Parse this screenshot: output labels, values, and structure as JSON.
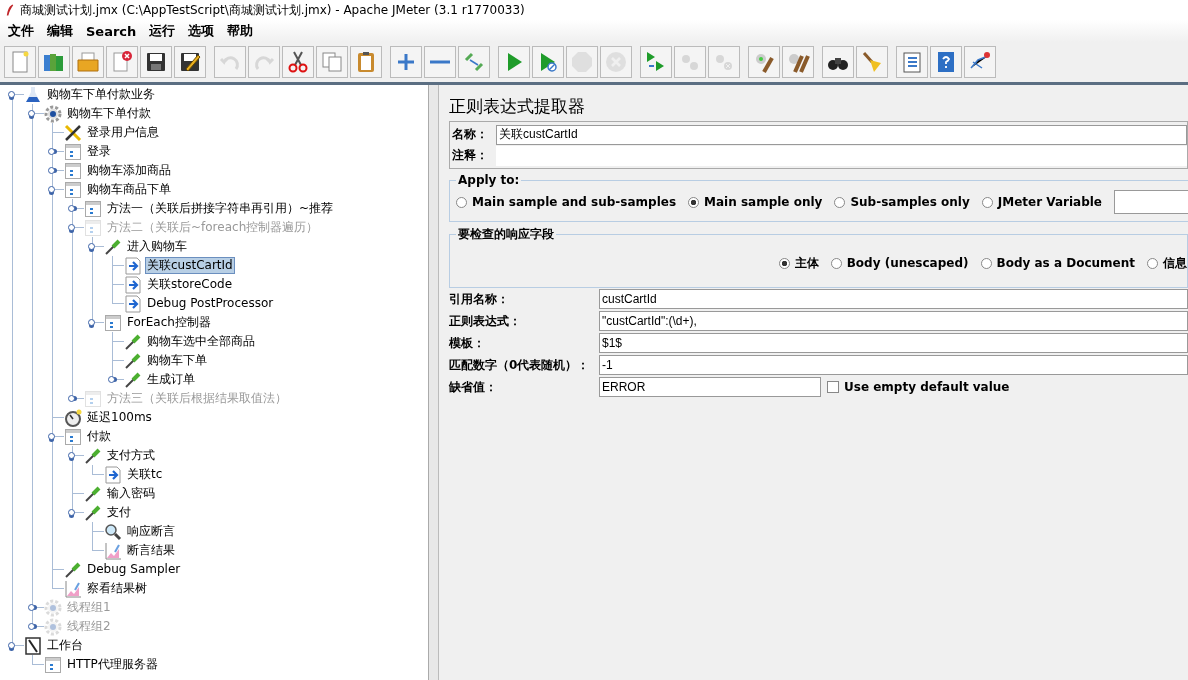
{
  "window": {
    "title": "商城测试计划.jmx (C:\\AppTestScript\\商城测试计划.jmx) - Apache JMeter (3.1 r1770033)"
  },
  "menu": [
    "文件",
    "编辑",
    "Search",
    "运行",
    "选项",
    "帮助"
  ],
  "toolbar": [
    [
      {
        "kind": "new",
        "disabled": false
      },
      {
        "kind": "templates",
        "disabled": false
      },
      {
        "kind": "open",
        "disabled": false
      },
      {
        "kind": "close",
        "disabled": false
      },
      {
        "kind": "save",
        "disabled": false
      },
      {
        "kind": "saveas",
        "disabled": false
      }
    ],
    [
      {
        "kind": "undo",
        "disabled": true
      },
      {
        "kind": "redo",
        "disabled": true
      },
      {
        "kind": "cut",
        "disabled": false
      },
      {
        "kind": "copy",
        "disabled": false
      },
      {
        "kind": "paste",
        "disabled": false
      }
    ],
    [
      {
        "kind": "add",
        "disabled": false
      },
      {
        "kind": "remove",
        "disabled": false
      },
      {
        "kind": "toggle",
        "disabled": false
      }
    ],
    [
      {
        "kind": "start",
        "disabled": false
      },
      {
        "kind": "startnotimer",
        "disabled": false
      },
      {
        "kind": "stop",
        "disabled": true
      },
      {
        "kind": "shutdown",
        "disabled": true
      }
    ],
    [
      {
        "kind": "remotestart",
        "disabled": false
      },
      {
        "kind": "remotestop",
        "disabled": true
      },
      {
        "kind": "remoteexit",
        "disabled": true
      }
    ],
    [
      {
        "kind": "clear",
        "disabled": false
      },
      {
        "kind": "clearall",
        "disabled": false
      }
    ],
    [
      {
        "kind": "search",
        "disabled": false
      },
      {
        "kind": "reset",
        "disabled": false
      }
    ],
    [
      {
        "kind": "functions",
        "disabled": false
      },
      {
        "kind": "help",
        "disabled": false
      },
      {
        "kind": "remotesearch",
        "disabled": false
      }
    ]
  ],
  "tree": [
    {
      "label": "购物车下单付款业务",
      "kind": "testplan",
      "expanded": true,
      "disabled": false,
      "selected": false,
      "children": [
        {
          "label": "购物车下单付款",
          "kind": "threadgroup",
          "expanded": true,
          "disabled": false,
          "selected": false,
          "children": [
            {
              "label": "登录用户信息",
              "kind": "config",
              "disabled": false,
              "selected": false
            },
            {
              "label": "登录",
              "kind": "controller",
              "expanded": false,
              "disabled": false,
              "selected": false
            },
            {
              "label": "购物车添加商品",
              "kind": "controller",
              "expanded": false,
              "disabled": false,
              "selected": false
            },
            {
              "label": "购物车商品下单",
              "kind": "controller",
              "expanded": true,
              "disabled": false,
              "selected": false,
              "children": [
                {
                  "label": "方法一（关联后拼接字符串再引用）~推荐",
                  "kind": "controller",
                  "expanded": false,
                  "disabled": false,
                  "selected": false
                },
                {
                  "label": "方法二（关联后~foreach控制器遍历）",
                  "kind": "controller",
                  "expanded": true,
                  "disabled": true,
                  "selected": false,
                  "children": [
                    {
                      "label": "进入购物车",
                      "kind": "sampler",
                      "expanded": true,
                      "disabled": false,
                      "selected": false,
                      "children": [
                        {
                          "label": "关联custCartId",
                          "kind": "postprocessor",
                          "disabled": false,
                          "selected": true
                        },
                        {
                          "label": "关联storeCode",
                          "kind": "postprocessor",
                          "disabled": false,
                          "selected": false
                        },
                        {
                          "label": "Debug PostProcessor",
                          "kind": "postprocessor",
                          "disabled": false,
                          "selected": false
                        }
                      ]
                    },
                    {
                      "label": "ForEach控制器",
                      "kind": "controller",
                      "expanded": true,
                      "disabled": false,
                      "selected": false,
                      "children": [
                        {
                          "label": "购物车选中全部商品",
                          "kind": "sampler",
                          "disabled": false,
                          "selected": false
                        },
                        {
                          "label": "购物车下单",
                          "kind": "sampler",
                          "disabled": false,
                          "selected": false
                        },
                        {
                          "label": "生成订单",
                          "kind": "sampler",
                          "expanded": false,
                          "disabled": false,
                          "selected": false
                        }
                      ]
                    }
                  ]
                },
                {
                  "label": "方法三（关联后根据结果取值法）",
                  "kind": "controller",
                  "expanded": false,
                  "disabled": true,
                  "selected": false
                }
              ]
            },
            {
              "label": "延迟100ms",
              "kind": "timer",
              "disabled": false,
              "selected": false
            },
            {
              "label": "付款",
              "kind": "controller",
              "expanded": true,
              "disabled": false,
              "selected": false,
              "children": [
                {
                  "label": "支付方式",
                  "kind": "sampler",
                  "expanded": true,
                  "disabled": false,
                  "selected": false,
                  "children": [
                    {
                      "label": "关联tc",
                      "kind": "postprocessor",
                      "disabled": false,
                      "selected": false
                    }
                  ]
                },
                {
                  "label": "输入密码",
                  "kind": "sampler",
                  "disabled": false,
                  "selected": false
                },
                {
                  "label": "支付",
                  "kind": "sampler",
                  "expanded": true,
                  "disabled": false,
                  "selected": false,
                  "children": [
                    {
                      "label": "响应断言",
                      "kind": "assertion",
                      "disabled": false,
                      "selected": false
                    },
                    {
                      "label": "断言结果",
                      "kind": "listener",
                      "disabled": false,
                      "selected": false
                    }
                  ]
                }
              ]
            },
            {
              "label": "Debug Sampler",
              "kind": "sampler",
              "disabled": false,
              "selected": false
            },
            {
              "label": "察看结果树",
              "kind": "listener",
              "disabled": false,
              "selected": false
            }
          ]
        },
        {
          "label": "线程组1",
          "kind": "threadgroup",
          "expanded": false,
          "disabled": true,
          "selected": false
        },
        {
          "label": "线程组2",
          "kind": "threadgroup",
          "expanded": false,
          "disabled": true,
          "selected": false
        }
      ]
    },
    {
      "label": "工作台",
      "kind": "workbench",
      "expanded": true,
      "disabled": false,
      "selected": false,
      "children": [
        {
          "label": "HTTP代理服务器",
          "kind": "controller",
          "disabled": false,
          "selected": false
        }
      ]
    }
  ],
  "panel": {
    "title": "正则表达式提取器",
    "name_label": "名称：",
    "name": "关联custCartId",
    "comment_label": "注释：",
    "apply_to": {
      "legend": "Apply to:",
      "options": [
        {
          "label": "Main sample and sub-samples",
          "selected": false
        },
        {
          "label": "Main sample only",
          "selected": true
        },
        {
          "label": "Sub-samples only",
          "selected": false
        },
        {
          "label": "JMeter Variable",
          "selected": false
        }
      ]
    },
    "field_to_check": {
      "legend": "要检查的响应字段",
      "options": [
        {
          "label": "主体",
          "selected": true
        },
        {
          "label": "Body (unescaped)",
          "selected": false
        },
        {
          "label": "Body as a Document",
          "selected": false
        },
        {
          "label": "信息",
          "selected": false
        }
      ]
    },
    "fields": [
      {
        "label": "引用名称：",
        "value": "custCartId"
      },
      {
        "label": "正则表达式：",
        "value": "\"custCartId\":(\\d+),"
      },
      {
        "label": "模板：",
        "value": "$1$"
      },
      {
        "label": "匹配数字（0代表随机）：",
        "value": "-1"
      },
      {
        "label": "缺省值：",
        "value": "ERROR",
        "checkbox": {
          "label": "Use empty default value",
          "checked": false
        }
      }
    ]
  }
}
